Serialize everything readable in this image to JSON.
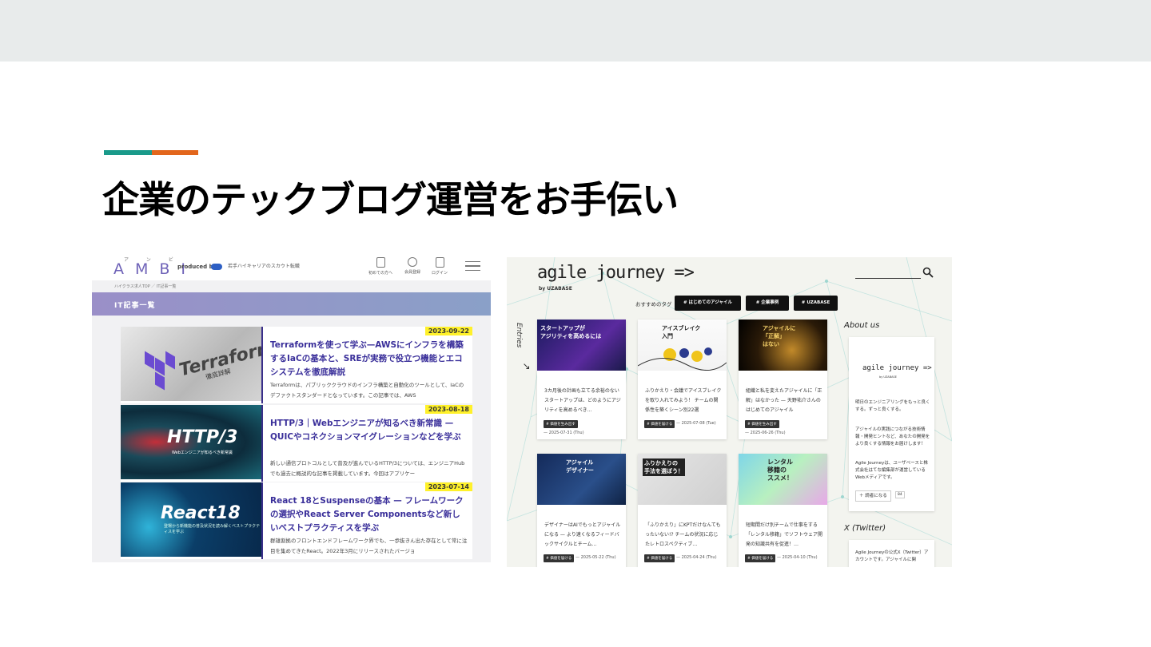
{
  "slide": {
    "title": "企業のテックブログ運営をお手伝い",
    "accent_colors": [
      "#1a9a8a",
      "#e2661c"
    ]
  },
  "ambi": {
    "ruby": "アンビ",
    "logo": "AMBI",
    "produced_by": "produced by",
    "tagline": "若手ハイキャリアのスカウト転職",
    "nav": [
      {
        "label": "初めての方へ",
        "icon": "document-icon"
      },
      {
        "label": "会員登録",
        "icon": "user-icon"
      },
      {
        "label": "ログイン",
        "icon": "login-icon"
      }
    ],
    "breadcrumb": "ハイクラス求人TOP ／ IT記事一覧",
    "section_title": "IT記事一覧",
    "brand_color": "#3a2f9a",
    "articles": [
      {
        "date": "2023-09-22",
        "thumb_title": "Terraform",
        "thumb_sub": "徹底詳解",
        "title": "Terraformを使って学ぶ—AWSにインフラを構築するIaCの基本と、SREが実務で役立つ機能とエコシステムを徹底解説",
        "desc": "Terraformは、パブリッククラウドのインフラ構築と自動化のツールとして、IaCのデファクトスタンダードとなっています。この記事では、AWS"
      },
      {
        "date": "2023-08-18",
        "thumb_title": "HTTP/3",
        "thumb_sub": "Webエンジニアが知るべき新常識",
        "title": "HTTP/3｜Webエンジニアが知るべき新常識 — QUICやコネクションマイグレーションなどを学ぶ",
        "desc": "新しい通信プロトコルとして普及が進んでいるHTTP/3については、エンジニアHubでも過去に概説的な記事を掲載しています。今回はアプリケー"
      },
      {
        "date": "2023-07-14",
        "thumb_title": "React18",
        "thumb_sub": "登場から新機能の普及状況を読み解くベストプラクティスを学ぶ",
        "title": "React 18とSuspenseの基本 — フレームワークの選択やReact Server Componentsなど新しいベストプラクティスを学ぶ",
        "desc": "群雄割拠のフロントエンドフレームワーク界でも、一歩抜きん出た存在として常に注目を集めてきたReact。2022年3月にリリースされたバージョ"
      }
    ]
  },
  "agile": {
    "logo": "agile journey =>",
    "by": "by UZABASE",
    "tags_label": "おすすめのタグ",
    "tags": [
      "# はじめてのアジャイル",
      "# 企業事例",
      "# UZABASE"
    ],
    "entries_label": "Entries",
    "posts": [
      {
        "cap": "スタートアップが\nアジリティを高めるには",
        "text": "3カ月後の計画も立てる余裕のないスタートアップは、どのようにアジリティを高めるべき…",
        "badge": "# 価値を生み出す",
        "date": "— 2025-07-31 (Thu)"
      },
      {
        "cap": "アイスブレイク\n入門",
        "text": "ふりかえり・会議でアイスブレイクを取り入れてみよう！ チームの関係性を築くシーン別22選",
        "badge": "# 価値を届ける",
        "date": "— 2025-07-08 (Tue)"
      },
      {
        "cap": "アジャイルに\n「正解」\nはない",
        "text": "組織と私を変えたアジャイルに「正解」はなかった — 天野祐介さんのはじめてのアジャイル",
        "badge": "# 価値を生み出す",
        "date": "— 2025-06-26 (Thu)"
      },
      {
        "cap": "アジャイル\nデザイナー",
        "text": "デザイナーはAIでもっとアジャイルになる — より速くなるフィードバックサイクルとチーム…",
        "badge": "# 価値を届ける",
        "date": "— 2025-05-22 (Thu)"
      },
      {
        "cap": "ふりかえりの\n手法を選ぼう！",
        "text": "「ふりかえり」にKPTだけなんてもったいない!? チームの状況に応じたレトロスペクティブ…",
        "badge": "# 価値を届ける",
        "date": "— 2025-04-24 (Thu)"
      },
      {
        "cap": "レンタル\n移籍の\nススメ！",
        "text": "短期間だけ別チームで仕事をする「レンタル移籍」でソフトウェア開発の知識共有を促進！…",
        "badge": "# 価値を届ける",
        "date": "— 2025-04-10 (Thu)"
      }
    ],
    "about_heading": "About us",
    "about_logo": "agile journey =>",
    "about_by": "by UZABASE",
    "about_p1": "明日のエンジニアリングをもっと良くする。ずっと良くする。",
    "about_p2": "アジャイルの実践につながる技術情報・開発ヒントなど、あなたの開発をより良くする情報をお届けします！",
    "about_p3": "Agile Journeyは、ユーザベースと株式会社はてな編集部が運営しているWebメディアです。",
    "follow_label": "＋ 読者になる",
    "follow_count": "84",
    "x_heading": "X (Twitter)",
    "x_text": "Agile Journeyの公式X（Twitter）アカウントです。アジャイルに関"
  }
}
